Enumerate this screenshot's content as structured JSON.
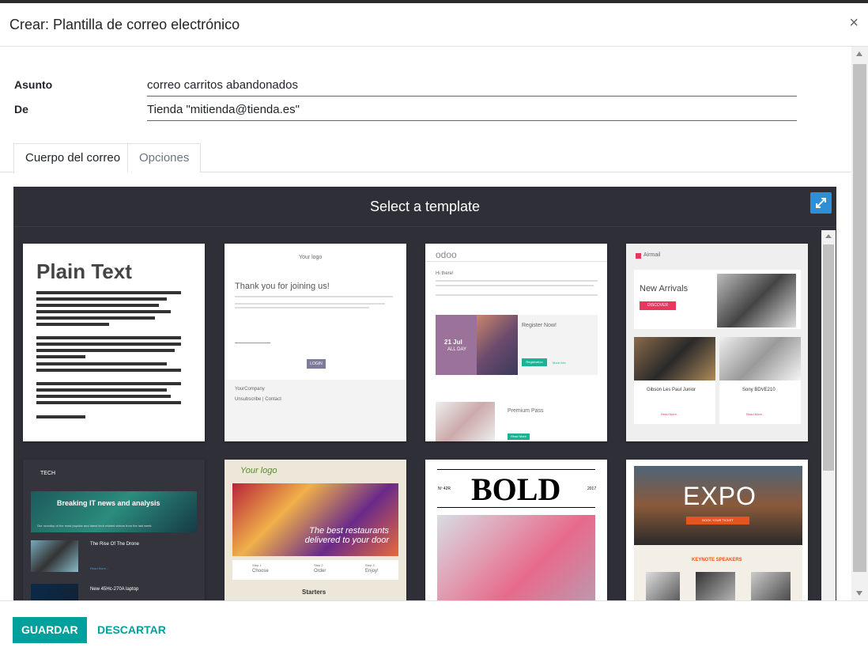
{
  "dialog": {
    "title": "Crear: Plantilla de correo electrónico",
    "close_glyph": "×"
  },
  "form": {
    "subject_label": "Asunto",
    "subject_value": "correo carritos abandonados",
    "from_label": "De",
    "from_value": "Tienda \"mitienda@tienda.es\""
  },
  "tabs": [
    {
      "label": "Cuerpo del correo",
      "active": true
    },
    {
      "label": "Opciones",
      "active": false
    }
  ],
  "editor": {
    "title": "Select a template",
    "templates": [
      {
        "name": "plain-text",
        "heading": "Plain Text"
      },
      {
        "name": "welcome",
        "logo": "Your logo",
        "heading": "Thank you for joining us!",
        "button": "LOGIN",
        "company": "YourCompany",
        "links": "Unsubscribe | Contact"
      },
      {
        "name": "event",
        "logo": "odoo",
        "hi": "Hi there!",
        "date": "21 Jul",
        "date_sub": "ALL DAY",
        "register": "Register Now!",
        "registration_btn": "Registration",
        "more_info": "More info",
        "premium": "Premium Pass",
        "read_more": "Read More"
      },
      {
        "name": "airmail",
        "logo": "Airmail",
        "headline": "New Arrivals",
        "discover": "DISCOVER",
        "product1": "Gibson Les Paul Junior",
        "product2": "Sony BDVE210",
        "read_more": "Read More..."
      },
      {
        "name": "tech",
        "logo": "TECH",
        "headline": "Breaking IT news and analysis",
        "sub": "Our roundup of the most popular and latest tech related videos from the last week",
        "article1": "The Rise Of The Drone",
        "read_more": "Read More...",
        "article2": "New 45Hc-270A laptop"
      },
      {
        "name": "restaurant",
        "logo": "Your logo",
        "banner": "The best restaurants delivered to your door",
        "step1_label": "Step 1",
        "step1": "Choose",
        "step2_label": "Step 2",
        "step2": "Order",
        "step3_label": "Step 3",
        "step3": "Enjoy!",
        "section": "Starters"
      },
      {
        "name": "bold",
        "issue": "Nº 42R",
        "year": "2017",
        "heading": "BOLD"
      },
      {
        "name": "expo",
        "heading": "EXPO",
        "button": "BOOK YOUR TICKET",
        "speakers": "KEYNOTE SPEAKERS"
      }
    ]
  },
  "footer": {
    "save": "GUARDAR",
    "discard": "DESCARTAR"
  },
  "colors": {
    "accent": "#00a09d",
    "editor_bg": "#2f2f37",
    "expand": "#2f8fd6"
  }
}
